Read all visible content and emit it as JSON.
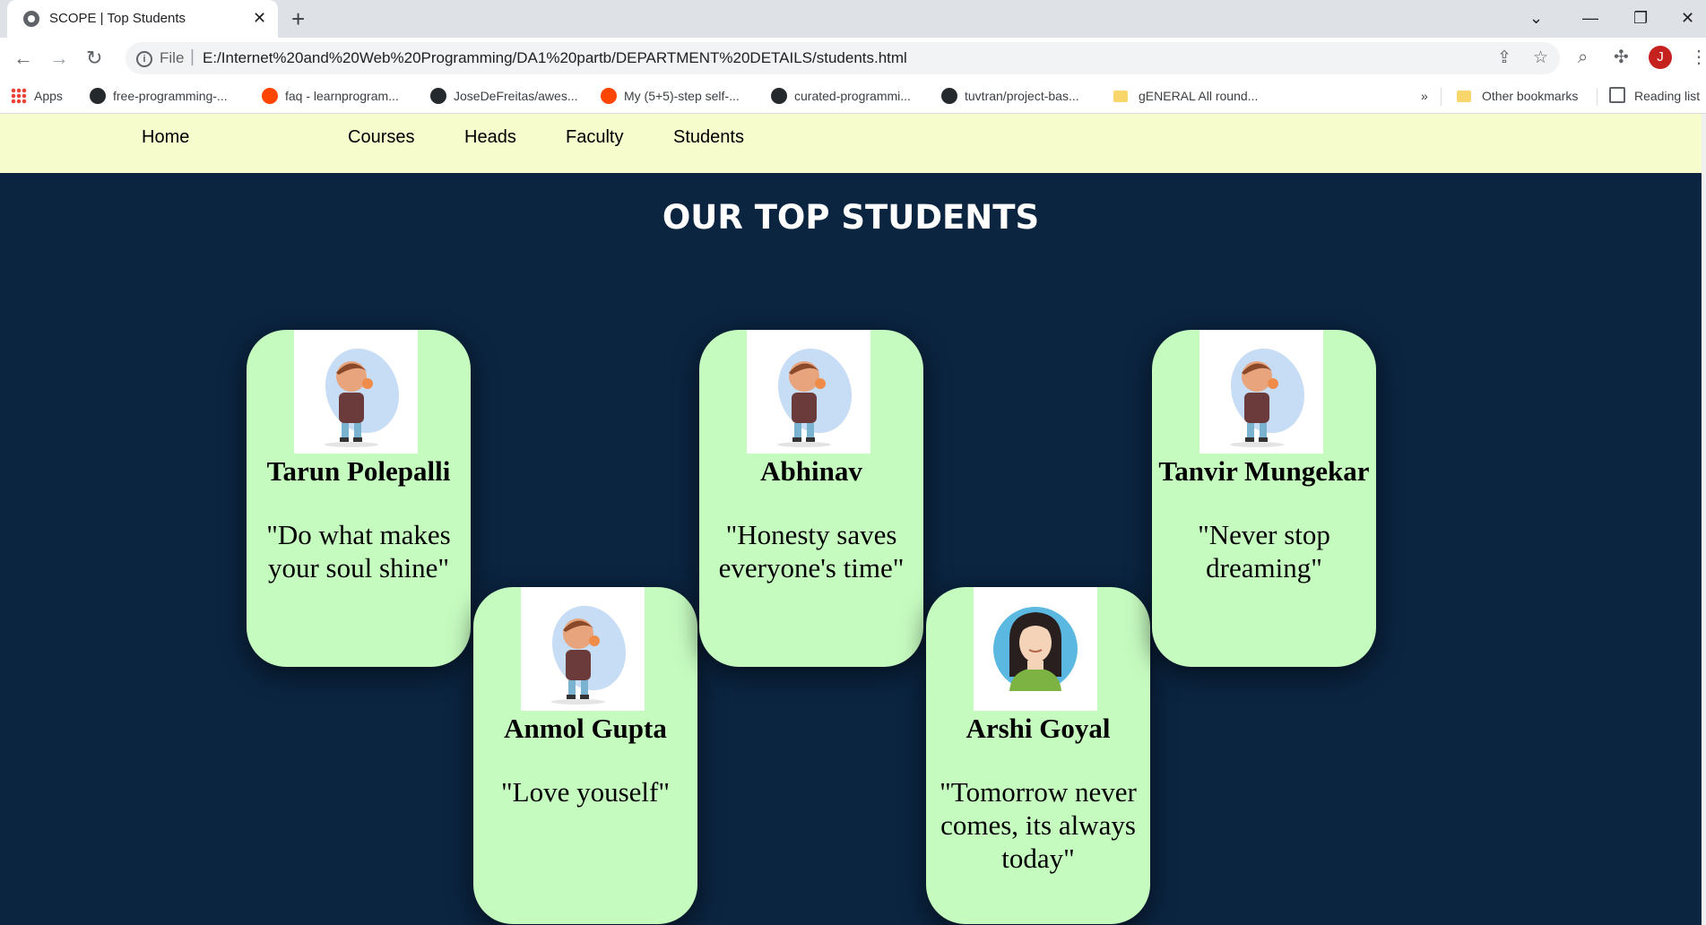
{
  "browser": {
    "tab_title": "SCOPE | Top Students",
    "file_label": "File",
    "url": "E:/Internet%20and%20Web%20Programming/DA1%20partb/DEPARTMENT%20DETAILS/students.html",
    "profile_initial": "J",
    "bookmarks": [
      {
        "label": "Apps",
        "icon": "apps-grid-icon"
      },
      {
        "label": "free-programming-...",
        "icon": "github-icon"
      },
      {
        "label": "faq - learnprogram...",
        "icon": "reddit-icon"
      },
      {
        "label": "JoseDeFreitas/awes...",
        "icon": "github-icon"
      },
      {
        "label": "My (5+5)-step self-...",
        "icon": "reddit-icon"
      },
      {
        "label": "curated-programmi...",
        "icon": "github-icon"
      },
      {
        "label": "tuvtran/project-bas...",
        "icon": "github-icon"
      },
      {
        "label": "gENERAL All round...",
        "icon": "folder-icon"
      }
    ],
    "overflow_label": "»",
    "other_bookmarks": "Other bookmarks",
    "reading_list": "Reading list"
  },
  "nav": {
    "items": [
      "Home",
      "Courses",
      "Heads",
      "Faculty",
      "Students"
    ]
  },
  "page": {
    "title": "OUR TOP STUDENTS",
    "background": "#0b2440",
    "card_color": "#c6fbc0",
    "nav_color": "#f6fccb"
  },
  "students": [
    {
      "name": "Tarun Polepalli",
      "quote": "\"Do what makes your soul shine\"",
      "avatar": "boy-avatar-icon"
    },
    {
      "name": "Anmol Gupta",
      "quote": "\"Love youself\"",
      "avatar": "boy-avatar-icon"
    },
    {
      "name": "Abhinav",
      "quote": "\"Honesty saves everyone's time\"",
      "avatar": "boy-avatar-icon"
    },
    {
      "name": "Arshi Goyal",
      "quote": "\"Tomorrow never comes, its always today\"",
      "avatar": "girl-avatar-icon"
    },
    {
      "name": "Tanvir Mungekar",
      "quote": "\"Never stop dreaming\"",
      "avatar": "boy-avatar-icon"
    }
  ]
}
